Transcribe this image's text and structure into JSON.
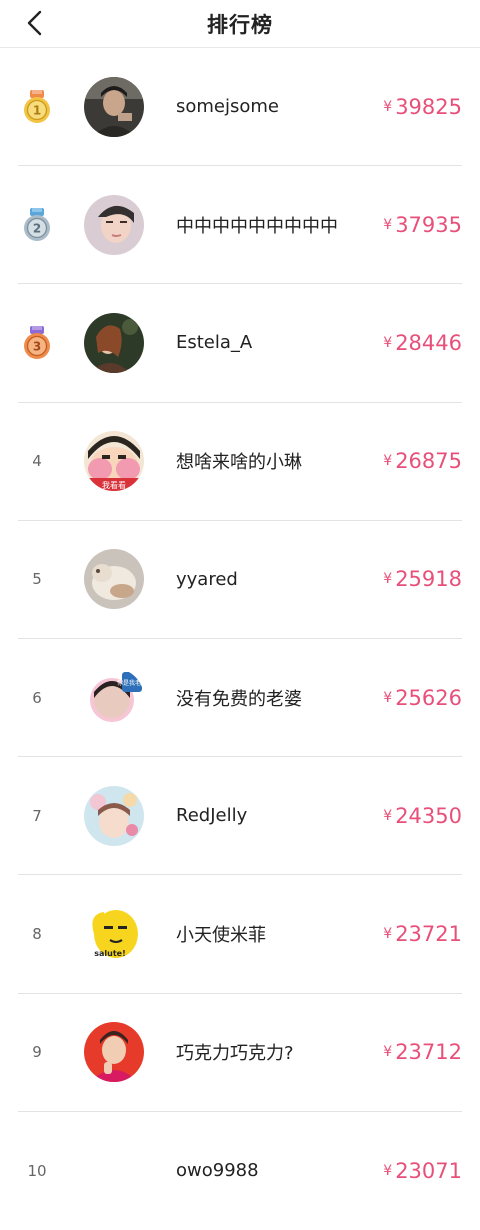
{
  "header": {
    "title": "排行榜"
  },
  "currency": "¥",
  "rows": [
    {
      "rank": "1",
      "name": "somejsome",
      "amount": "39825",
      "medal": "gold"
    },
    {
      "rank": "2",
      "name": "中中中中中中中中中",
      "amount": "37935",
      "medal": "silver"
    },
    {
      "rank": "3",
      "name": "Estela_A",
      "amount": "28446",
      "medal": "bronze"
    },
    {
      "rank": "4",
      "name": "想啥来啥的小琳",
      "amount": "26875"
    },
    {
      "rank": "5",
      "name": "yyared",
      "amount": "25918"
    },
    {
      "rank": "6",
      "name": "没有免费的老婆",
      "amount": "25626"
    },
    {
      "rank": "7",
      "name": "RedJelly",
      "amount": "24350"
    },
    {
      "rank": "8",
      "name": "小天使米菲",
      "amount": "23721"
    },
    {
      "rank": "9",
      "name": "巧克力巧克力?",
      "amount": "23712"
    },
    {
      "rank": "10",
      "name": "owo9988",
      "amount": "23071"
    }
  ],
  "avatar_stickers": {
    "r4": "我看看",
    "r6": "你是我老婆",
    "r8": "salute!"
  },
  "colors": {
    "amount": "#e8507a",
    "gold": "#f3c343",
    "silver": "#a9bcc8",
    "bronze": "#f08a4b",
    "divider": "#e3e3e3"
  }
}
